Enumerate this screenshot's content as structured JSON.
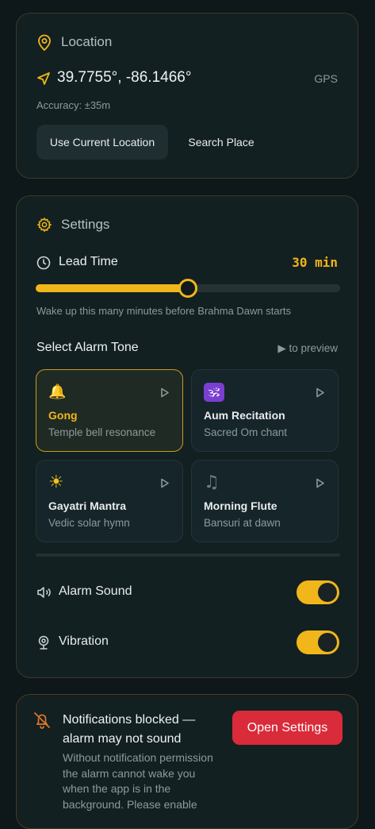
{
  "location": {
    "title": "Location",
    "coords": "39.7755°, -86.1466°",
    "source": "GPS",
    "accuracy": "Accuracy: ±35m",
    "use_current_label": "Use Current Location",
    "search_label": "Search Place"
  },
  "settings": {
    "title": "Settings",
    "lead_time_label": "Lead Time",
    "lead_time_value": "30 min",
    "lead_time_fraction": 0.5,
    "lead_time_hint": "Wake up this many minutes before Brahma Dawn starts",
    "tone_heading": "Select Alarm Tone",
    "preview_hint": "▶ to preview",
    "tones": [
      {
        "emoji": "🔔",
        "name": "Gong",
        "desc": "Temple bell resonance",
        "selected": true
      },
      {
        "emoji": "🕉",
        "name": "Aum Recitation",
        "desc": "Sacred Om chant",
        "selected": false
      },
      {
        "emoji": "☀",
        "name": "Gayatri Mantra",
        "desc": "Vedic solar hymn",
        "selected": false
      },
      {
        "emoji": "♫",
        "name": "Morning Flute",
        "desc": "Bansuri at dawn",
        "selected": false
      }
    ],
    "alarm_sound_label": "Alarm Sound",
    "alarm_sound_on": true,
    "vibration_label": "Vibration",
    "vibration_on": true
  },
  "notification": {
    "title": "Notifications blocked — alarm may not sound",
    "body": "Without notification permission the alarm cannot wake you when the app is in the background. Please enable",
    "button_label": "Open Settings"
  },
  "colors": {
    "accent": "#f0b61a",
    "danger": "#d92b3a",
    "background": "#0e1719",
    "card": "#132022"
  }
}
